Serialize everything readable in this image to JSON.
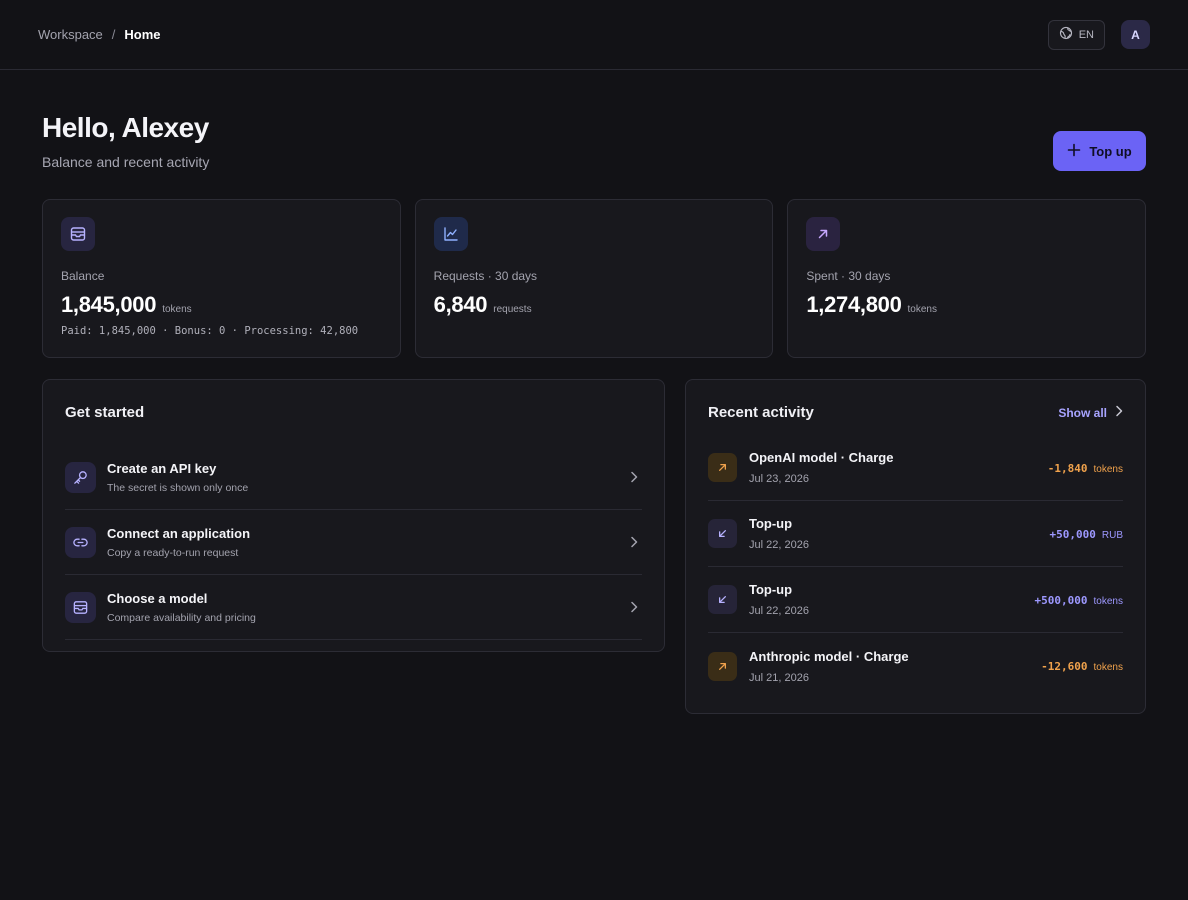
{
  "header": {
    "breadcrumb": {
      "root": "Workspace",
      "separator": "/",
      "current": "Home"
    },
    "lang_label": "EN",
    "avatar_initial": "A"
  },
  "hero": {
    "title": "Hello, Alexey",
    "subtitle": "Balance and recent activity",
    "topup_label": "Top up"
  },
  "stats": [
    {
      "icon": "wallet-icon",
      "label": "Balance",
      "value": "1,845,000",
      "unit": "tokens",
      "foot": "Paid: 1,845,000 · Bonus: 0 · Processing: 42,800"
    },
    {
      "icon": "chart-line-icon",
      "label": "Requests · 30 days",
      "value": "6,840",
      "unit": "requests"
    },
    {
      "icon": "arrow-up-right-icon",
      "label": "Spent · 30 days",
      "value": "1,274,800",
      "unit": "tokens"
    }
  ],
  "get_started": {
    "title": "Get started",
    "items": [
      {
        "icon": "key-icon",
        "title": "Create an API key",
        "desc": "The secret is shown only once"
      },
      {
        "icon": "link-icon",
        "title": "Connect an application",
        "desc": "Copy a ready-to-run request"
      },
      {
        "icon": "box-icon",
        "title": "Choose a model",
        "desc": "Compare availability and pricing"
      }
    ]
  },
  "activity": {
    "title": "Recent activity",
    "show_all": "Show all",
    "items": [
      {
        "kind": "charge",
        "title": "OpenAI model · Charge",
        "date": "Jul 23, 2026",
        "amount": "-1,840",
        "unit": "tokens"
      },
      {
        "kind": "topup",
        "title": "Top-up",
        "date": "Jul 22, 2026",
        "amount": "+50,000",
        "unit": "RUB"
      },
      {
        "kind": "topup",
        "title": "Top-up",
        "date": "Jul 22, 2026",
        "amount": "+500,000",
        "unit": "tokens"
      },
      {
        "kind": "charge",
        "title": "Anthropic model · Charge",
        "date": "Jul 21, 2026",
        "amount": "-12,600",
        "unit": "tokens"
      }
    ]
  },
  "colors": {
    "background": "#121216",
    "card": "#18181d",
    "accent": "#6b63f5",
    "negative": "#f0a24c",
    "positive": "#9d98ff"
  }
}
